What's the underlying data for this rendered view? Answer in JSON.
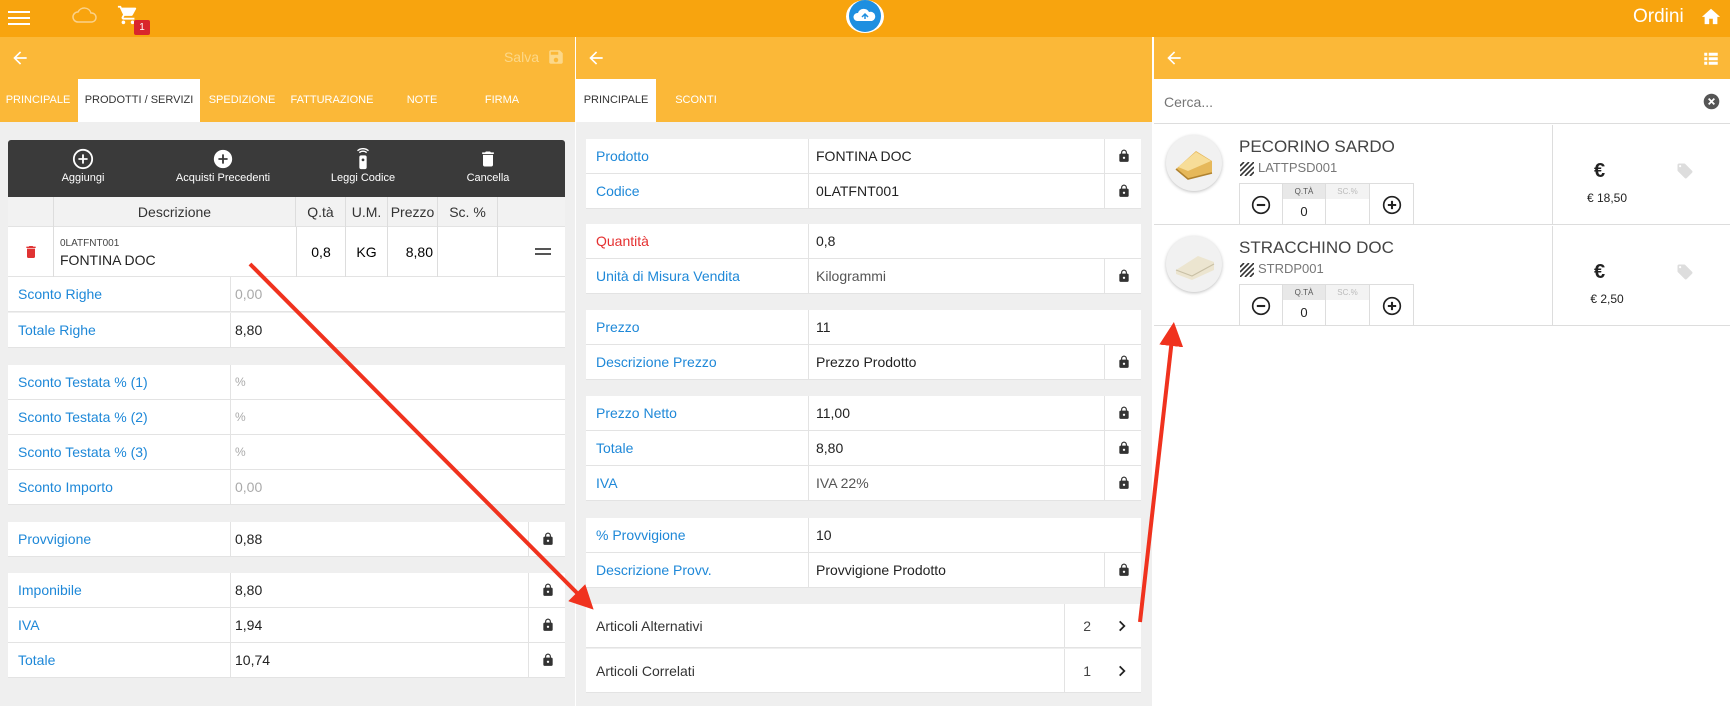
{
  "topbar": {
    "title": "Ordini",
    "cart_count": "1"
  },
  "left": {
    "salva": "Salva",
    "tabs": [
      "PRINCIPALE",
      "PRODOTTI / SERVIZI",
      "SPEDIZIONE",
      "FATTURAZIONE",
      "NOTE",
      "FIRMA"
    ],
    "toolbar": [
      "Aggiungi",
      "Acquisti Precedenti",
      "Leggi Codice",
      "Cancella"
    ],
    "columns": [
      "Descrizione",
      "Q.tà",
      "U.M.",
      "Prezzo",
      "Sc. %"
    ],
    "line": {
      "code": "0LATFNT001",
      "name": "FONTINA DOC",
      "qty": "0,8",
      "um": "KG",
      "price": "8,80",
      "disc": ""
    },
    "sconto_righe": {
      "label": "Sconto Righe",
      "value": "0,00"
    },
    "totale_righe": {
      "label": "Totale Righe",
      "value": "8,80"
    },
    "sconto1": {
      "label": "Sconto Testata % (1)",
      "value": "%"
    },
    "sconto2": {
      "label": "Sconto Testata % (2)",
      "value": "%"
    },
    "sconto3": {
      "label": "Sconto Testata % (3)",
      "value": "%"
    },
    "sconto_imp": {
      "label": "Sconto Importo",
      "value": "0,00"
    },
    "provvigione": {
      "label": "Provvigione",
      "value": "0,88"
    },
    "imponibile": {
      "label": "Imponibile",
      "value": "8,80"
    },
    "iva": {
      "label": "IVA",
      "value": "1,94"
    },
    "totale": {
      "label": "Totale",
      "value": "10,74"
    }
  },
  "middle": {
    "tabs": [
      "PRINCIPALE",
      "SCONTI"
    ],
    "prodotto": {
      "label": "Prodotto",
      "value": "FONTINA DOC"
    },
    "codice": {
      "label": "Codice",
      "value": "0LATFNT001"
    },
    "quantita": {
      "label": "Quantità",
      "value": "0,8"
    },
    "um": {
      "label": "Unità di Misura Vendita",
      "value": "Kilogrammi"
    },
    "prezzo": {
      "label": "Prezzo",
      "value": "11"
    },
    "desc_prezzo": {
      "label": "Descrizione Prezzo",
      "value": "Prezzo Prodotto"
    },
    "prezzo_netto": {
      "label": "Prezzo Netto",
      "value": "11,00"
    },
    "totale": {
      "label": "Totale",
      "value": "8,80"
    },
    "iva": {
      "label": "IVA",
      "value": "IVA 22%"
    },
    "provv": {
      "label": "% Provvigione",
      "value": "10"
    },
    "desc_provv": {
      "label": "Descrizione Provv.",
      "value": "Provvigione Prodotto"
    },
    "alternativi": {
      "label": "Articoli Alternativi",
      "count": "2"
    },
    "correlati": {
      "label": "Articoli Correlati",
      "count": "1"
    }
  },
  "right": {
    "search_placeholder": "Cerca...",
    "products": [
      {
        "name": "PECORINO SARDO",
        "code": "LATTPSD001",
        "qty_label": "Q.TÀ",
        "disc_label": "SC.%",
        "qty": "0",
        "euro": "€",
        "price": "€ 18,50"
      },
      {
        "name": "STRACCHINO DOC",
        "code": "STRDP001",
        "qty_label": "Q.TÀ",
        "disc_label": "SC.%",
        "qty": "0",
        "euro": "€",
        "price": "€ 2,50"
      }
    ]
  }
}
